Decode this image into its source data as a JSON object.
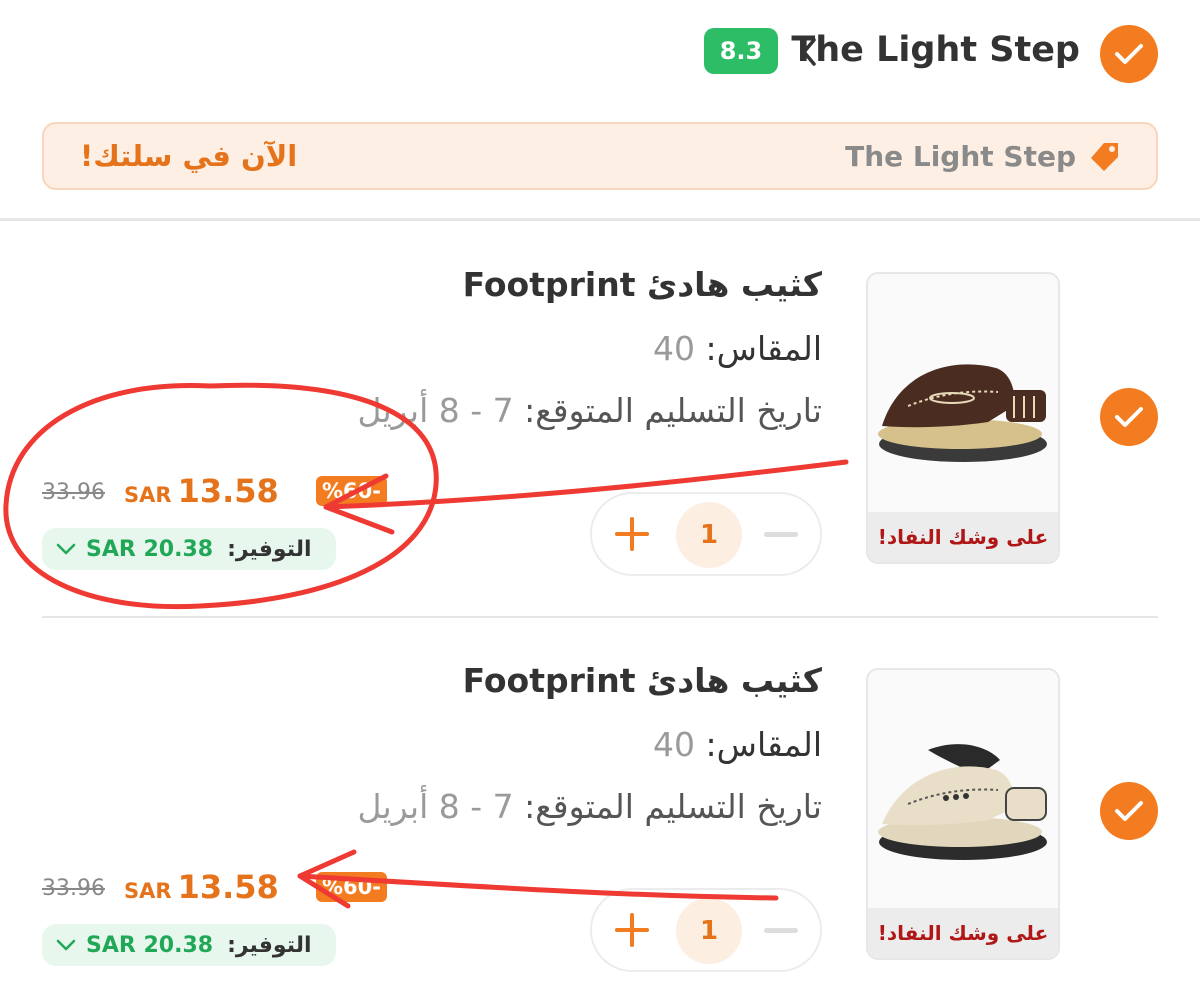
{
  "header": {
    "store_name": "The Light Step",
    "rating": "8.3"
  },
  "banner": {
    "store_name": "The Light Step",
    "message": "الآن في سلتك!"
  },
  "items": [
    {
      "brand": "Footprint",
      "name": "كثيب هادئ",
      "size_label": "المقاس:",
      "size_value": "40",
      "delivery_label": "تاريخ التسليم المتوقع:",
      "delivery_value": "7 - 8 أبريل",
      "old_price": "33.96",
      "currency": "SAR",
      "price": "13.58",
      "discount": "%60-",
      "saving_label": "التوفير:",
      "saving_value": "SAR 20.38",
      "quantity": "1",
      "stock_badge": "على وشك النفاد!"
    },
    {
      "brand": "Footprint",
      "name": "كثيب هادئ",
      "size_label": "المقاس:",
      "size_value": "40",
      "delivery_label": "تاريخ التسليم المتوقع:",
      "delivery_value": "7 - 8 أبريل",
      "old_price": "33.96",
      "currency": "SAR",
      "price": "13.58",
      "discount": "%60-",
      "saving_label": "التوفير:",
      "saving_value": "SAR 20.38",
      "quantity": "1",
      "stock_badge": "على وشك النفاد!"
    }
  ],
  "colors": {
    "accent": "#f47c20",
    "rating_green": "#2ebd67",
    "saving_green": "#21a857",
    "annotation_red": "#ee3a32"
  },
  "icons": [
    "check-icon",
    "chevron-left-icon",
    "tag-icon",
    "plus-icon",
    "minus-icon",
    "chevron-down-icon"
  ]
}
